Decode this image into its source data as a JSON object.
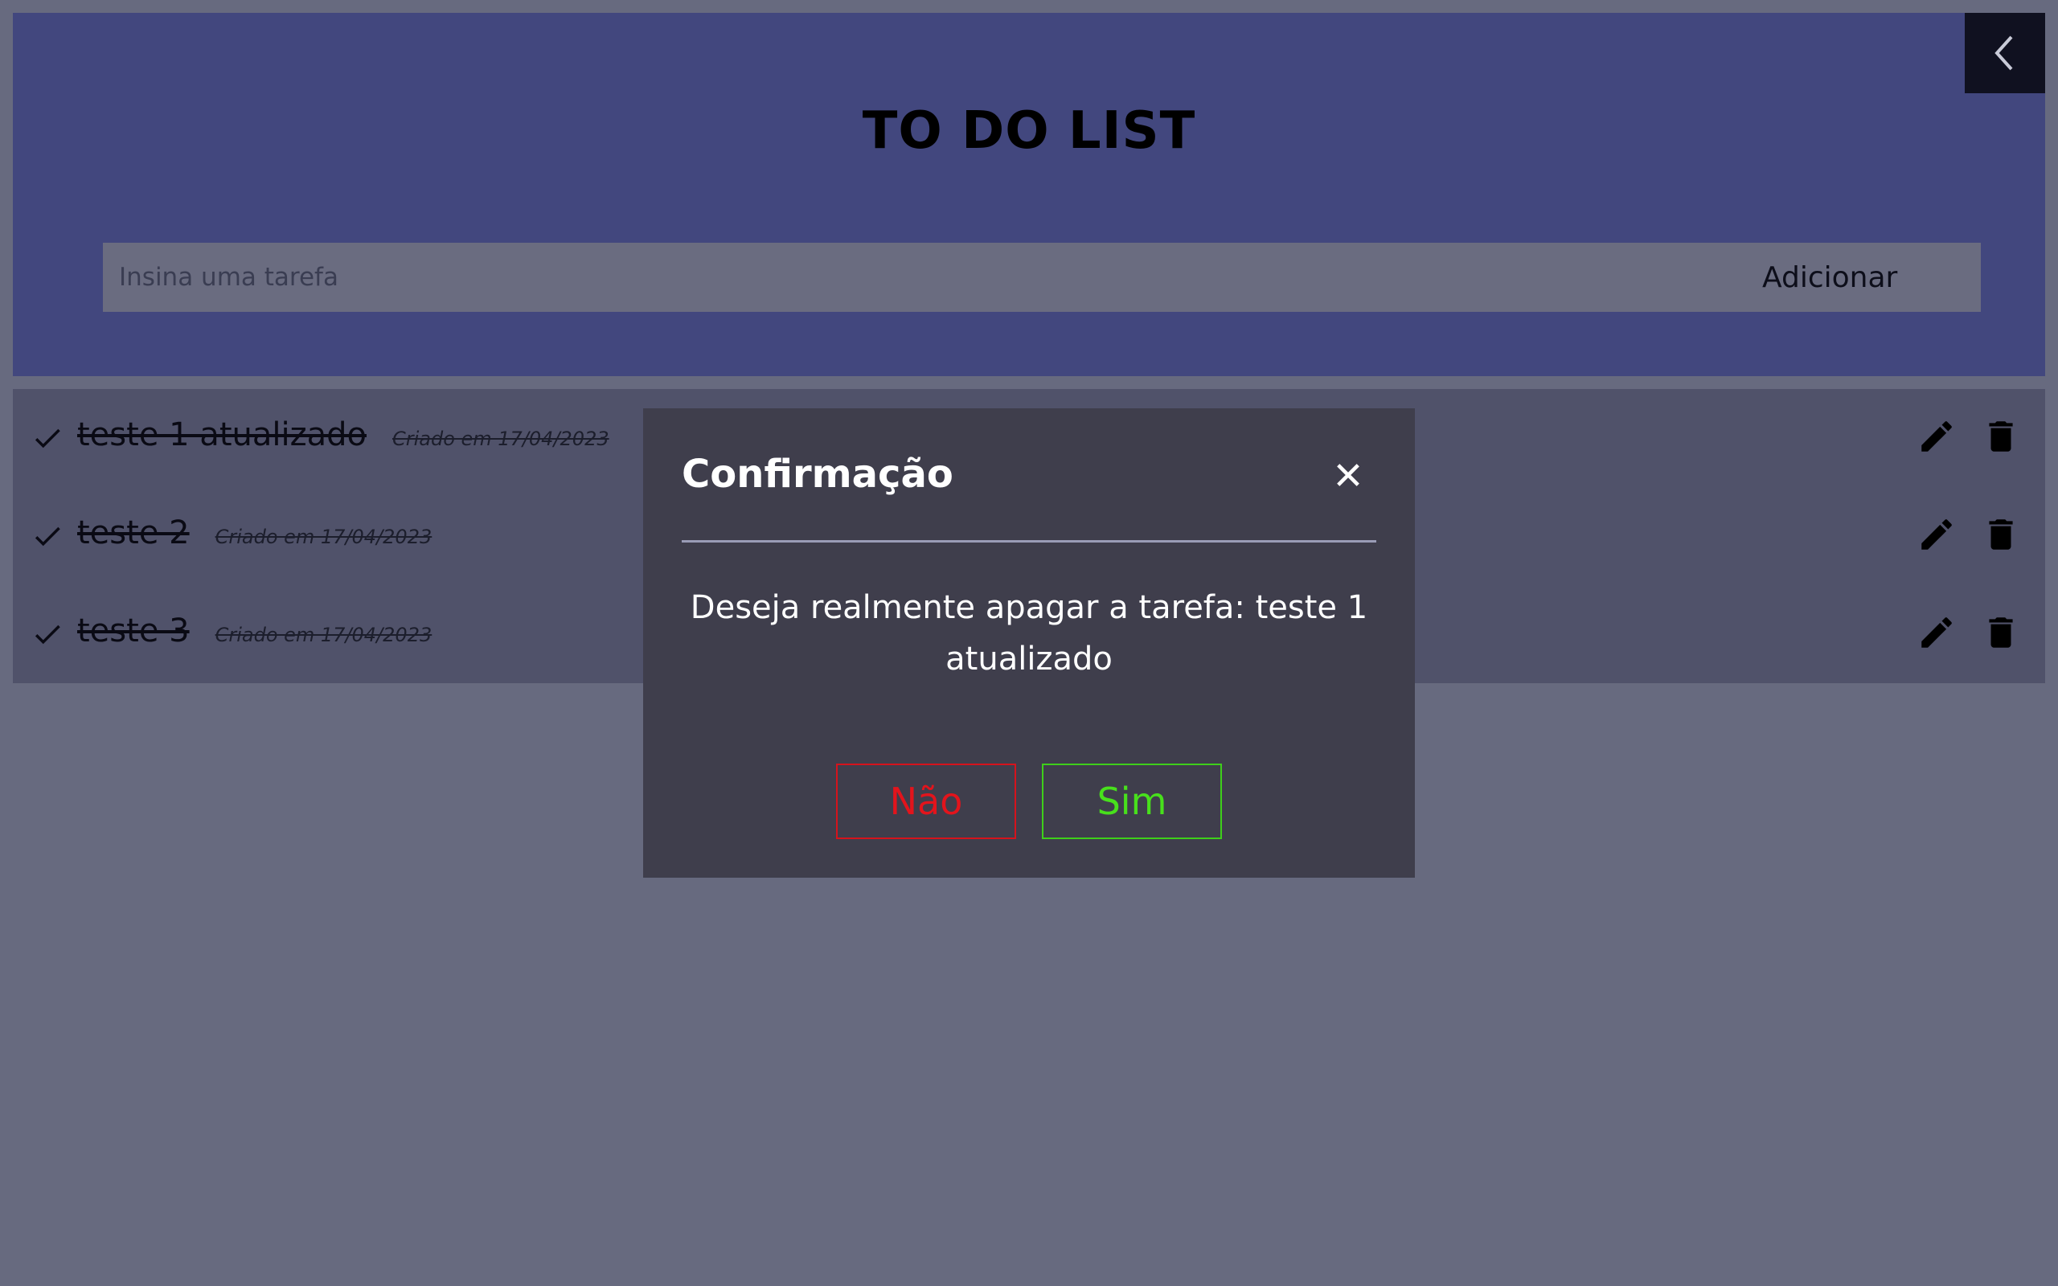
{
  "header": {
    "title": "TO DO LIST",
    "input_placeholder": "Insina uma tarefa",
    "add_label": "Adicionar"
  },
  "collapse_icon": "chevron-left-icon",
  "tasks": [
    {
      "text": "teste 1 atualizado",
      "date": "Criado em 17/04/2023",
      "done": true
    },
    {
      "text": "teste 2",
      "date": "Criado em 17/04/2023",
      "done": true
    },
    {
      "text": "teste 3",
      "date": "Criado em 17/04/2023",
      "done": true
    }
  ],
  "modal": {
    "title": "Confirmação",
    "message": "Deseja realmente apagar a tarefa: teste 1 atualizado",
    "no_label": "Não",
    "yes_label": "Sim"
  },
  "colors": {
    "page_bg": "#676a7f",
    "header_bg": "#42477e",
    "list_bg": "#50526a",
    "modal_bg": "#3f3e4c",
    "no_color": "#e3141c",
    "yes_color": "#48e01c"
  }
}
